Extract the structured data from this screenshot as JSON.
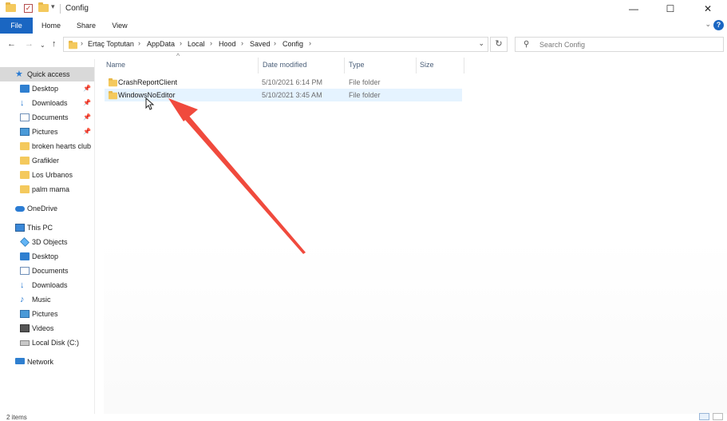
{
  "window": {
    "title": "Config",
    "controls": {
      "minimize": "—",
      "maximize": "☐",
      "close": "✕"
    }
  },
  "ribbon": {
    "tabs": [
      "File",
      "Home",
      "Share",
      "View"
    ],
    "help": "?",
    "expand": "⌄"
  },
  "navigation": {
    "back": "←",
    "forward": "→",
    "recent": "⌄",
    "up": "↑",
    "breadcrumb": [
      "Ertaç Toptutan",
      "AppData",
      "Local",
      "Hood",
      "Saved",
      "Config"
    ],
    "separator": "›",
    "dropdown": "⌄",
    "refresh": "↻"
  },
  "search": {
    "placeholder": "Search Config",
    "icon": "search-icon"
  },
  "sidebar": {
    "quick_access": {
      "label": "Quick access",
      "items": [
        {
          "label": "Desktop",
          "pinned": true,
          "icon": "desktop-icon"
        },
        {
          "label": "Downloads",
          "pinned": true,
          "icon": "downloads-icon"
        },
        {
          "label": "Documents",
          "pinned": true,
          "icon": "documents-icon"
        },
        {
          "label": "Pictures",
          "pinned": true,
          "icon": "pictures-icon"
        },
        {
          "label": "broken hearts club",
          "pinned": false,
          "icon": "folder-icon"
        },
        {
          "label": "Grafikler",
          "pinned": false,
          "icon": "folder-icon"
        },
        {
          "label": "Los Urbanos",
          "pinned": false,
          "icon": "folder-icon"
        },
        {
          "label": "palm mama",
          "pinned": false,
          "icon": "folder-icon"
        }
      ]
    },
    "onedrive": "OneDrive",
    "this_pc": {
      "label": "This PC",
      "items": [
        "3D Objects",
        "Desktop",
        "Documents",
        "Downloads",
        "Music",
        "Pictures",
        "Videos",
        "Local Disk (C:)"
      ]
    },
    "network": "Network"
  },
  "columns": {
    "name": "Name",
    "date": "Date modified",
    "type": "Type",
    "size": "Size",
    "sort": "^"
  },
  "files": [
    {
      "name": "CrashReportClient",
      "date": "5/10/2021 6:14 PM",
      "type": "File folder"
    },
    {
      "name": "WindowsNoEditor",
      "date": "5/10/2021 3:45 AM",
      "type": "File folder",
      "hovered": true
    }
  ],
  "status": {
    "items": "2 items"
  },
  "colors": {
    "accent": "#1a66c2",
    "arrow": "#f04a3d",
    "folder": "#f4c95d",
    "hover": "#e5f3ff",
    "selected": "#d9d9d9"
  }
}
